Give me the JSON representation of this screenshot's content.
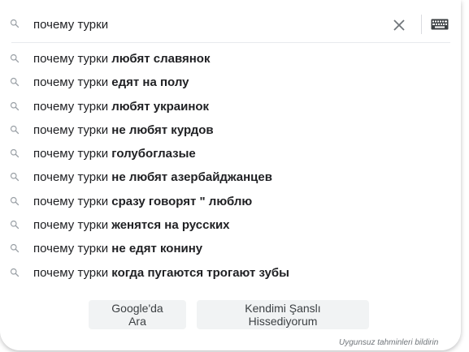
{
  "search": {
    "query": "почему турки"
  },
  "suggestions": [
    {
      "prefix": "почему турки ",
      "completion": "любят славянок"
    },
    {
      "prefix": "почему турки ",
      "completion": "едят на полу"
    },
    {
      "prefix": "почему турки ",
      "completion": "любят украинок"
    },
    {
      "prefix": "почему турки ",
      "completion": "не любят курдов"
    },
    {
      "prefix": "почему турки ",
      "completion": "голубоглазые"
    },
    {
      "prefix": "почему турки ",
      "completion": "не любят азербайджанцев"
    },
    {
      "prefix": "почему турки ",
      "completion": "сразу говорят \" люблю"
    },
    {
      "prefix": "почему турки ",
      "completion": "женятся на русских"
    },
    {
      "prefix": "почему турки ",
      "completion": "не едят конину"
    },
    {
      "prefix": "почему турки ",
      "completion": "когда пугаются трогают зубы"
    }
  ],
  "buttons": {
    "search_label": "Google'da Ara",
    "lucky_label": "Kendimi Şanslı Hissediyorum"
  },
  "footer": {
    "report_label": "Uygunsuz tahminleri bildirin"
  },
  "icons": {
    "search": "search-icon",
    "clear": "close-icon",
    "keyboard": "keyboard-icon"
  },
  "colors": {
    "text": "#202124",
    "icon": "#9aa0a6",
    "button_bg": "#f1f3f4",
    "muted": "#70757a"
  }
}
